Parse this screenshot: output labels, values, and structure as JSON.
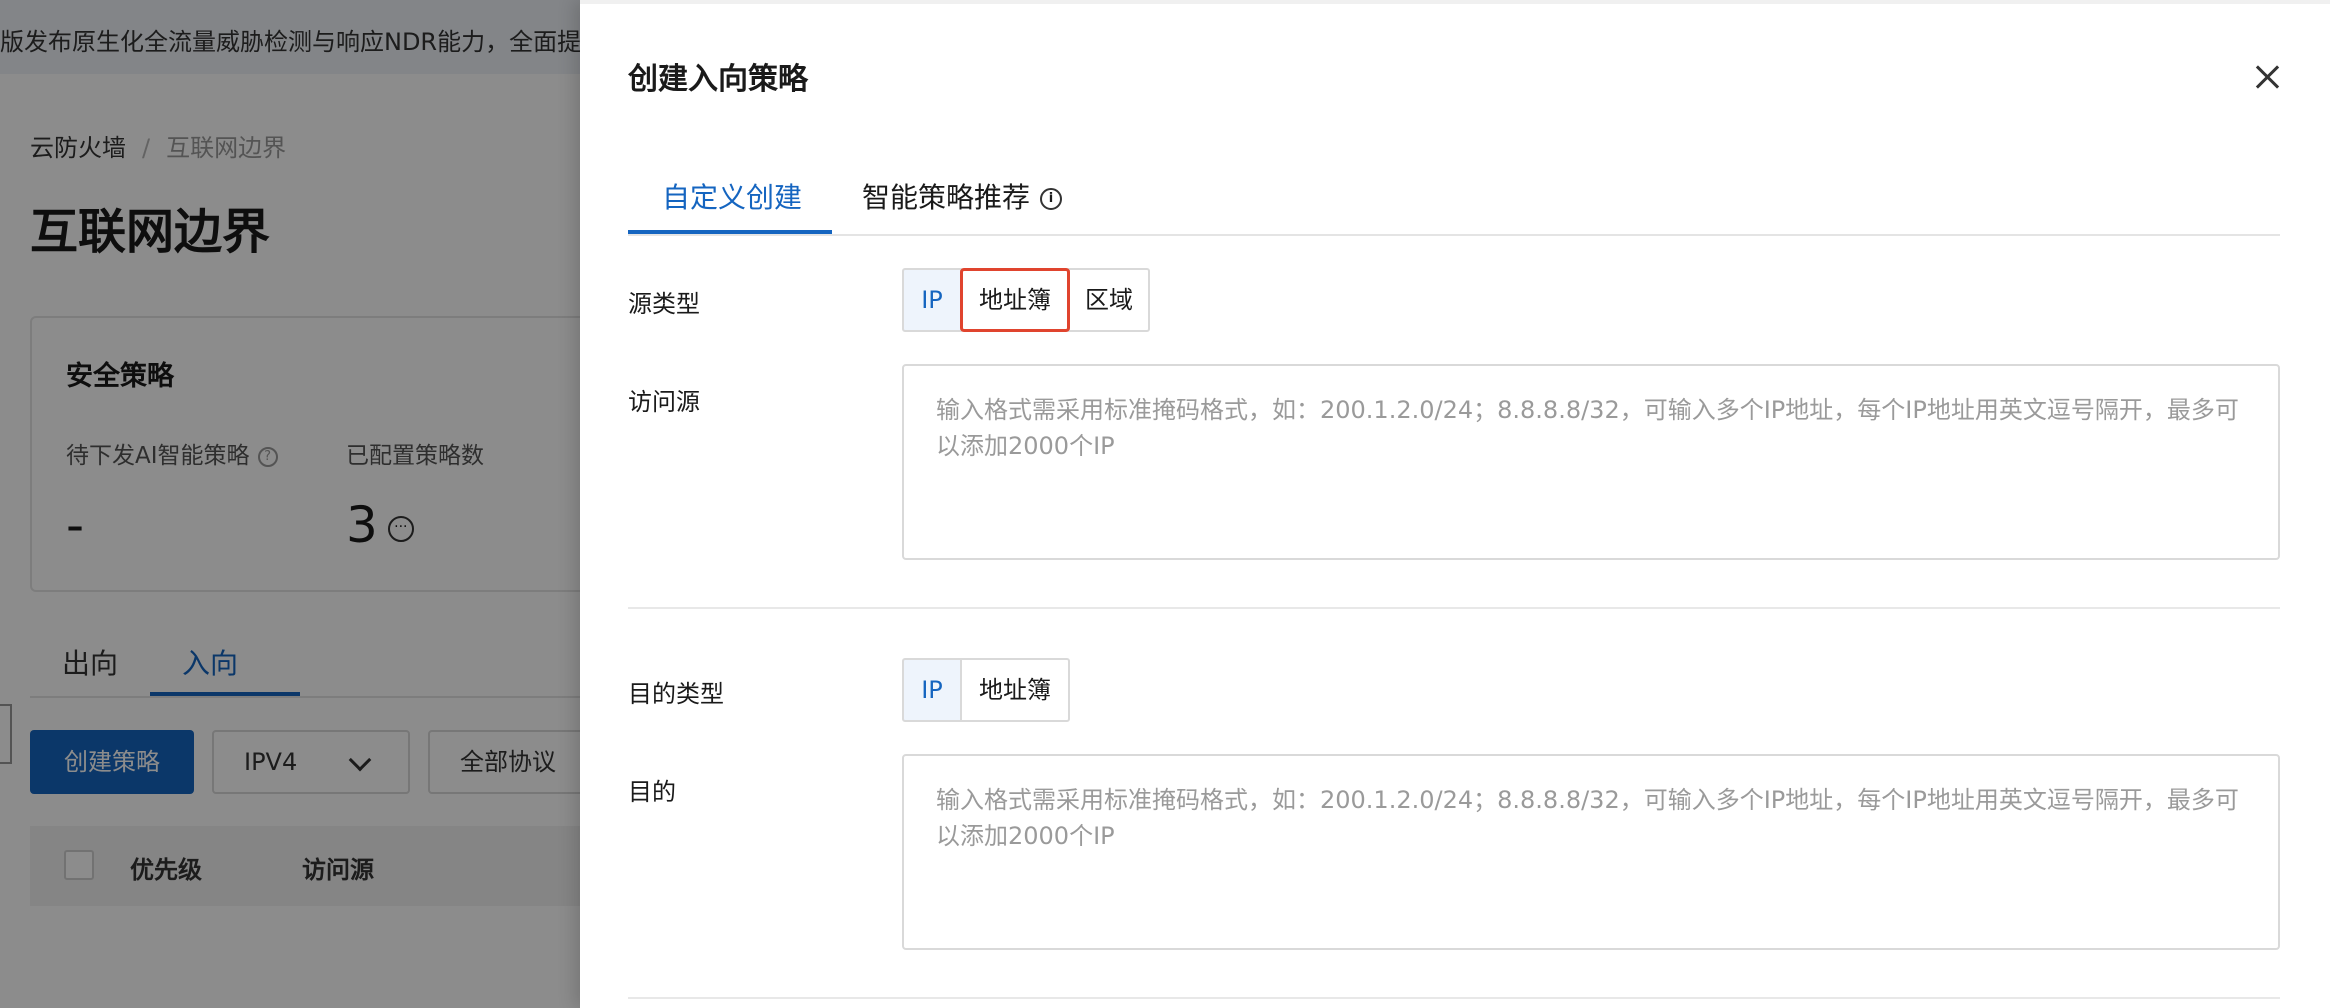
{
  "background": {
    "banner_text": "版发布原生化全流量威胁检测与响应NDR能力，全面提升",
    "breadcrumb": [
      "云防火墙",
      "互联网边界"
    ],
    "page_title": "互联网边界",
    "card": {
      "title": "安全策略",
      "stat1_label": "待下发AI智能策略",
      "stat1_value": "-",
      "stat2_label": "已配置策略数",
      "stat2_value": "3"
    },
    "direction_tabs": [
      "出向",
      "入向"
    ],
    "active_direction": "入向",
    "create_button": "创建策略",
    "ip_version": "IPV4",
    "protocol": "全部协议",
    "table_headers": [
      "优先级",
      "访问源"
    ]
  },
  "drawer": {
    "title": "创建入向策略",
    "tabs": [
      "自定义创建",
      "智能策略推荐"
    ],
    "active_tab": "自定义创建",
    "source_type_label": "源类型",
    "source_type_options": [
      "IP",
      "地址簿",
      "区域"
    ],
    "source_type_selected": "IP",
    "source_label": "访问源",
    "source_placeholder": "输入格式需采用标准掩码格式，如：200.1.2.0/24；8.8.8.8/32，可输入多个IP地址，每个IP地址用英文逗号隔开，最多可以添加2000个IP",
    "dest_type_label": "目的类型",
    "dest_type_options": [
      "IP",
      "地址簿"
    ],
    "dest_type_selected": "IP",
    "dest_label": "目的",
    "dest_placeholder": "输入格式需采用标准掩码格式，如：200.1.2.0/24；8.8.8.8/32，可输入多个IP地址，每个IP地址用英文逗号隔开，最多可以添加2000个IP"
  },
  "colors": {
    "accent": "#1565c0",
    "highlight": "#e0442e"
  }
}
